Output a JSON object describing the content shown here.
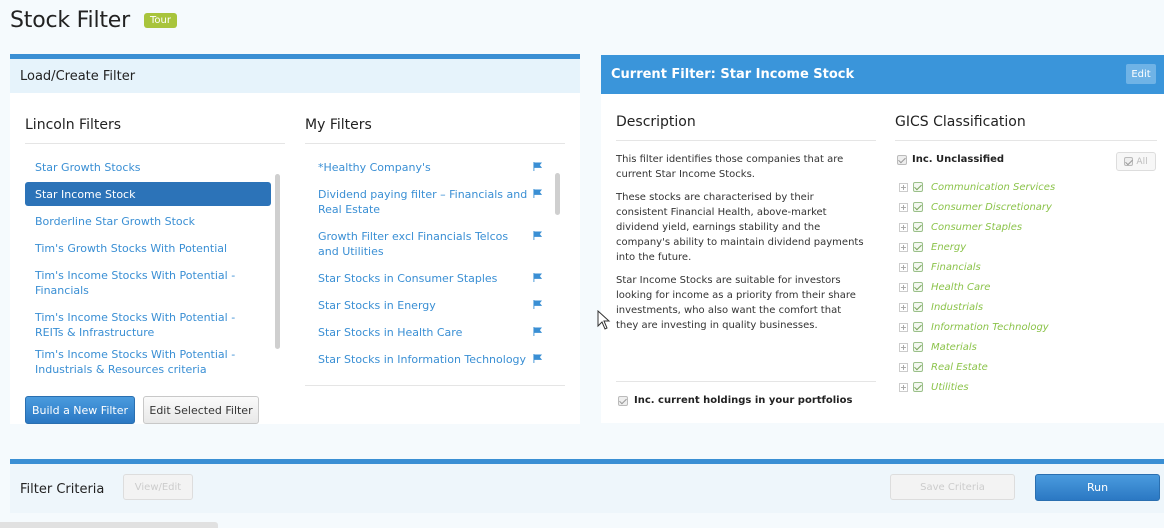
{
  "page": {
    "title": "Stock Filter",
    "tour_label": "Tour"
  },
  "load_panel": {
    "title": "Load/Create Filter",
    "lincoln_title": "Lincoln Filters",
    "my_filters_title": "My Filters",
    "lincoln_filters": [
      "Star Growth Stocks",
      "Star Income Stock",
      "Borderline Star Growth Stock",
      "Tim's Growth Stocks With Potential",
      "Tim's Income Stocks With Potential - Financials",
      "Tim's Income Stocks With Potential - REITs & Infrastructure",
      "Tim's Income Stocks With Potential - Industrials & Resources criteria"
    ],
    "my_filters": [
      "*Healthy Company's",
      "Dividend paying filter – Financials and Real Estate",
      "Growth Filter excl Financials Telcos and Utilities",
      "Star Stocks in Consumer Staples",
      "Star Stocks in Energy",
      "Star Stocks in Health Care",
      "Star Stocks in Information Technology"
    ],
    "build_button": "Build a New Filter",
    "edit_button": "Edit Selected Filter"
  },
  "current_panel": {
    "title": "Current Filter: Star Income Stock",
    "edit_label": "Edit",
    "description_title": "Description",
    "description_paragraphs": [
      "This filter identifies those companies that are current Star Income Stocks.",
      "These stocks are characterised by their consistent Financial Health, above-market dividend yield, earnings stability and the company's ability to maintain dividend payments into the future.",
      "Star Income Stocks are suitable for investors looking for income as a priority from their share investments, who also want the comfort that they are investing in quality businesses."
    ],
    "holdings_label": "Inc. current holdings in your portfolios",
    "gics_title": "GICS Classification",
    "unclassified_label": "Inc. Unclassified",
    "all_label": "All",
    "sectors": [
      "Communication Services",
      "Consumer Discretionary",
      "Consumer Staples",
      "Energy",
      "Financials",
      "Health Care",
      "Industrials",
      "Information Technology",
      "Materials",
      "Real Estate",
      "Utilities"
    ]
  },
  "criteria": {
    "title": "Filter Criteria",
    "view_edit_label": "View/Edit",
    "save_label": "Save Criteria",
    "run_label": "Run"
  },
  "colors": {
    "accent": "#3a8fd4",
    "selected": "#2c73b8",
    "sector_green": "#8bc34a",
    "tour": "#a8c43c"
  }
}
